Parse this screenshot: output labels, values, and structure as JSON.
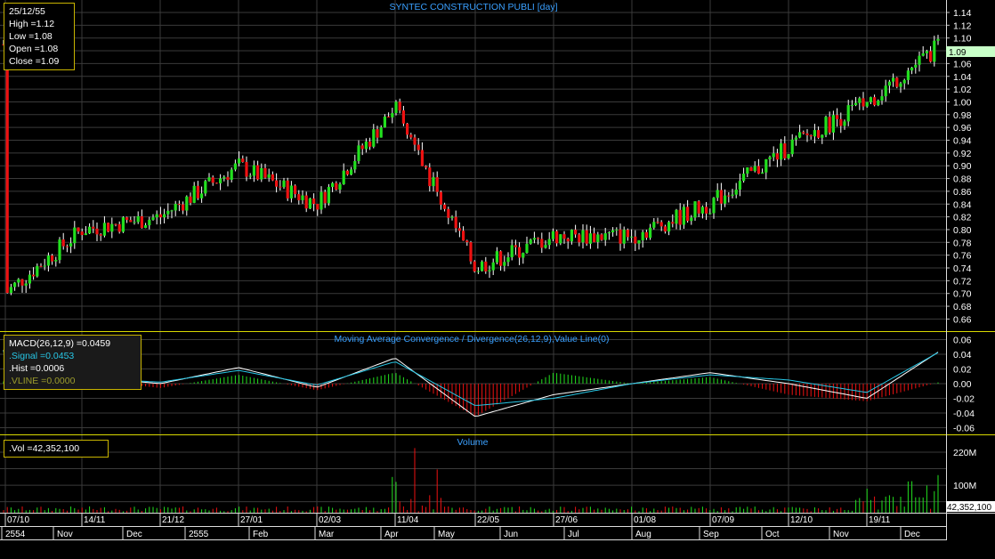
{
  "colors": {
    "background": "#000000",
    "grid": "#3a3a3a",
    "up": "#22e01e",
    "down": "#ee1111",
    "separator": "#d8d800",
    "title": "#3aa0ff",
    "macd": "#ffffff",
    "signal": "#27c7e6",
    "last_price_bg": "#c8ffc8"
  },
  "price_panel": {
    "title": "SYNTEC CONSTRUCTION PUBLI [day]",
    "info": {
      "date": "25/12/55",
      "high": "High =1.12",
      "low": "Low =1.08",
      "open": "Open =1.08",
      "close": "Close =1.09"
    },
    "y_ticks": [
      "1.14",
      "1.12",
      "1.10",
      "1.08",
      "1.06",
      "1.04",
      "1.02",
      "1.00",
      "0.98",
      "0.96",
      "0.94",
      "0.92",
      "0.90",
      "0.88",
      "0.86",
      "0.84",
      "0.82",
      "0.80",
      "0.78",
      "0.76",
      "0.74",
      "0.72",
      "0.70",
      "0.68",
      "0.66"
    ],
    "last_price": "1.09"
  },
  "macd_panel": {
    "title": "Moving Average Convergence / Divergence(26,12,9),Value Line(0)",
    "info": {
      "macd": "MACD(26,12,9)   =0.0459",
      "signal": ".Signal  =0.0453",
      "hist": ".Hist  =0.0006",
      "vline": ".VLINE   =0.0000"
    },
    "y_ticks": [
      "0.06",
      "0.04",
      "0.02",
      "0.00",
      "-0.02",
      "-0.04",
      "-0.06"
    ]
  },
  "volume_panel": {
    "title": "Volume",
    "info": {
      "vol": ".Vol   =42,352,100"
    },
    "y_ticks": [
      "220M",
      "100M"
    ],
    "last_volume": "42,352,100"
  },
  "x_axis": {
    "dates": [
      "07/10",
      "14/11",
      "21/12",
      "27/01",
      "02/03",
      "11/04",
      "22/05",
      "27/06",
      "01/08",
      "07/09",
      "12/10",
      "19/11"
    ],
    "months": [
      "2554",
      "Nov",
      "Dec",
      "2555",
      "Feb",
      "Mar",
      "Apr",
      "May",
      "Jun",
      "Jul",
      "Aug",
      "Sep",
      "Oct",
      "Nov",
      "Dec"
    ]
  },
  "chart_data": [
    {
      "type": "candlestick",
      "title": "SYNTEC CONSTRUCTION PUBLI [day]",
      "ylim": [
        0.65,
        1.15
      ],
      "last_close": 1.09,
      "close_path": [
        {
          "date": "07/10",
          "close": 0.7
        },
        {
          "date": "14/11",
          "close": 0.8
        },
        {
          "date": "21/12",
          "close": 0.82
        },
        {
          "date": "27/01",
          "close": 0.9
        },
        {
          "date": "02/03",
          "close": 0.84
        },
        {
          "date": "11/04",
          "close": 0.99
        },
        {
          "date": "22/05",
          "close": 0.74
        },
        {
          "date": "27/06",
          "close": 0.79
        },
        {
          "date": "01/08",
          "close": 0.79
        },
        {
          "date": "07/09",
          "close": 0.84
        },
        {
          "date": "12/10",
          "close": 0.93
        },
        {
          "date": "19/11",
          "close": 1.0
        },
        {
          "date": "25/12/55",
          "close": 1.09
        }
      ],
      "last_bar": {
        "date": "25/12/55",
        "open": 1.08,
        "high": 1.12,
        "low": 1.08,
        "close": 1.09
      }
    },
    {
      "type": "line",
      "title": "Moving Average Convergence / Divergence(26,12,9),Value Line(0)",
      "ylim": [
        -0.065,
        0.065
      ],
      "series": [
        {
          "name": "MACD(26,12,9)",
          "values": [
            0.018,
            0.01,
            0.0,
            0.022,
            -0.005,
            0.035,
            -0.045,
            -0.015,
            0.0,
            0.015,
            0.0,
            -0.02,
            0.046
          ],
          "last": 0.0459
        },
        {
          "name": "Signal",
          "values": [
            0.015,
            0.008,
            0.002,
            0.018,
            -0.002,
            0.03,
            -0.03,
            -0.02,
            0.0,
            0.012,
            0.005,
            -0.012,
            0.045
          ],
          "last": 0.0453
        },
        {
          "name": "Hist",
          "last": 0.0006
        },
        {
          "name": "VLINE",
          "last": 0.0
        }
      ]
    },
    {
      "type": "bar",
      "title": "Volume",
      "y_ticks_M": [
        100,
        220
      ],
      "last": 42352100
    }
  ]
}
